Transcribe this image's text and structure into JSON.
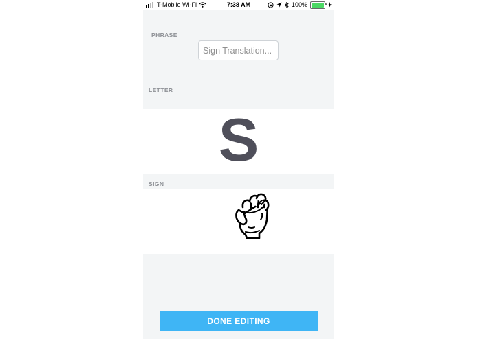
{
  "status_bar": {
    "carrier": "T-Mobile Wi-Fi",
    "time": "7:38 AM",
    "battery_percent": "100%",
    "battery_level": 1.0,
    "battery_color": "#4cd964"
  },
  "phrase": {
    "label": "PHRASE",
    "placeholder": "Sign Translation..."
  },
  "letter": {
    "label": "LETTER",
    "value": "S"
  },
  "sign": {
    "label": "SIGN",
    "icon": "fist-sign-s-icon"
  },
  "actions": {
    "done_label": "DONE EDITING",
    "done_color": "#3fb5f5"
  }
}
